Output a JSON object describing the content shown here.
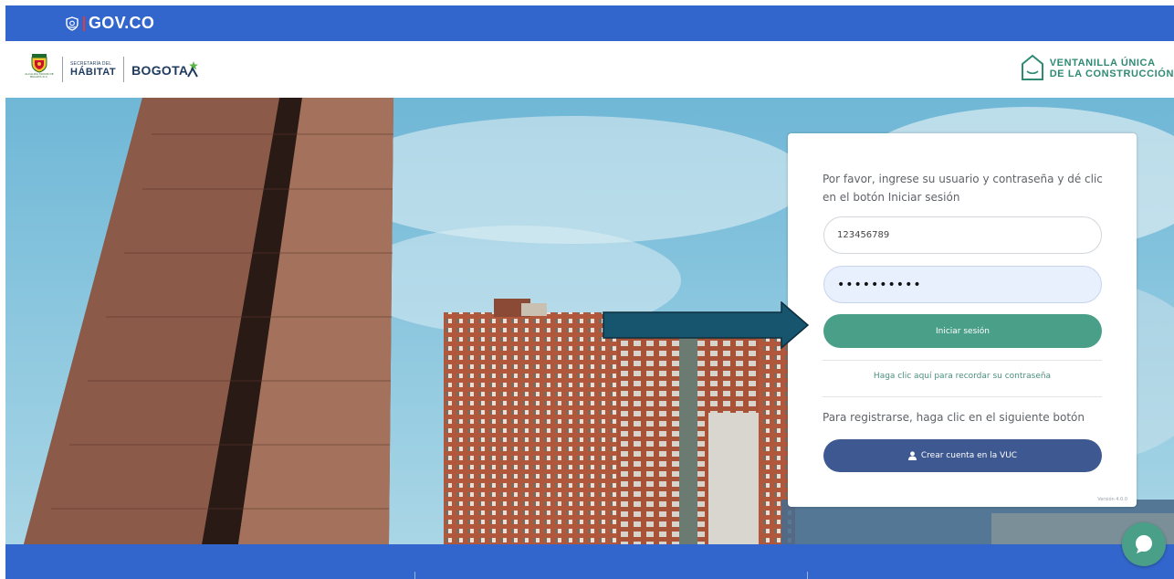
{
  "gov_bar": {
    "logo_text": "GOV.CO",
    "color": "#3366cc"
  },
  "header": {
    "secretaria_small": "SECRETARÍA DEL",
    "secretaria_big": "HÁBITAT",
    "bogota": "BOGOTA",
    "escudo_label": "ALCALDÍA MAYOR DE BOGOTÁ D.C.",
    "vuc_line1": "VENTANILLA ÚNICA",
    "vuc_line2": "DE LA CONSTRUCCIÓN",
    "vuc_color": "#2f8a73"
  },
  "login": {
    "intro": "Por favor, ingrese su usuario y contraseña y dé clic en el botón Iniciar sesión",
    "username_value": "123456789",
    "password_mask": "••••••••••",
    "login_label": "Iniciar sesión",
    "forgot_label": "Haga clic aquí para recordar su contraseña",
    "register_text": "Para registrarse, haga clic en el siguiente botón",
    "create_label": "Crear cuenta en la VUC",
    "version": "Versión 4.0.0",
    "login_color": "#4a9f88",
    "create_color": "#3e5891"
  },
  "icons": {
    "gov": "shield-icon",
    "user": "user-icon",
    "chat": "chat-bubble-icon",
    "arrow": "arrow-right-icon"
  }
}
